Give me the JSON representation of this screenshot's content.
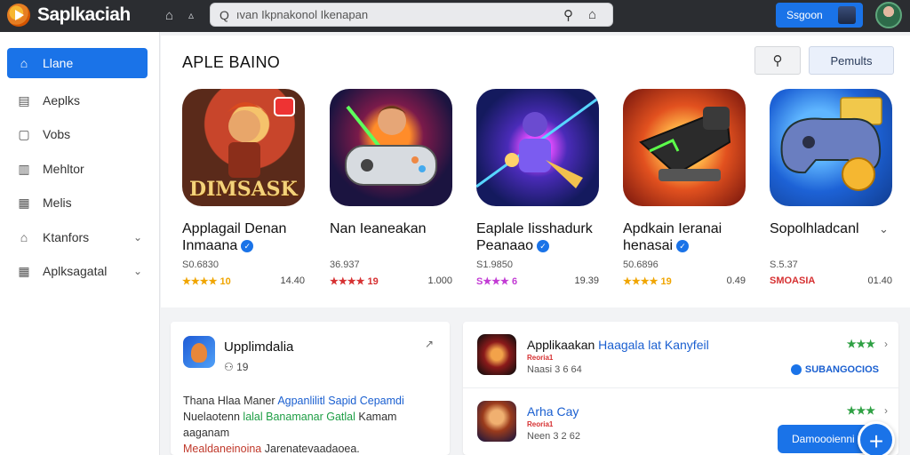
{
  "header": {
    "app_title": "Saplkaciah",
    "search_query_icon": "Q",
    "search_placeholder": "ıvan Ikpnakonol Ikenapan",
    "signin_label": "Ssgoon"
  },
  "sidebar": {
    "items": [
      {
        "label": "Llane",
        "icon": "home-icon"
      },
      {
        "label": "Aeplks",
        "icon": "apps-icon"
      },
      {
        "label": "Vobs",
        "icon": "docs-icon"
      },
      {
        "label": "Mehltor",
        "icon": "chart-icon"
      },
      {
        "label": "Melis",
        "icon": "calendar-icon"
      },
      {
        "label": "Ktanfors",
        "icon": "book-icon"
      },
      {
        "label": "Aplksagatal",
        "icon": "grid-icon"
      }
    ]
  },
  "main": {
    "section_title": "APLE BAINO",
    "permits_label": "Pemults",
    "apps": [
      {
        "name": "Applagail Denan Inmaana",
        "verified": true,
        "size": "S0.6830",
        "rating": "★★★★ 10",
        "price": "14.40",
        "icon_text": "DIMSASK"
      },
      {
        "name": "Nan Ieaneakan",
        "verified": false,
        "size": "36.937",
        "rating": "★★★★ 19",
        "price": "1.000"
      },
      {
        "name": "Eaplale Iisshadurk Peanaao",
        "verified": true,
        "size": "S1.9850",
        "rating": "S★★★ 6",
        "price": "19.39"
      },
      {
        "name": "Apdkain Ieranai henasai",
        "verified": true,
        "size": "50.6896",
        "rating": "★★★★ 19",
        "price": "0.49"
      },
      {
        "name": "Sopolhladcanl",
        "verified": false,
        "size": "S.5.37",
        "rating": "SMOASIA",
        "price": "01.40"
      }
    ]
  },
  "featured": {
    "title": "Upplimdalia",
    "sub": "19",
    "body_line1_a": "Thana Hlaa Maner ",
    "body_line1_b": "Agpanlilitl Sapid Cepamdi",
    "body_line2_a": "Nuelaotenn ",
    "body_line2_b": "lalal Banamanar Gatlal",
    "body_line2_c": " Kamam aaganam",
    "body_line3_a": "Mealdaneinoina",
    "body_line3_b": " Jarenatevaadaoea."
  },
  "list": {
    "rows": [
      {
        "title_a": "Applikaakan ",
        "title_b": "Haagala lat Kanyfeil",
        "tag": "Reoria1",
        "meta": "Naasi 3 6 64",
        "stars": "★★★",
        "status": "SUBANGOCIOS"
      },
      {
        "title_a": "",
        "title_b": "Arha Cay",
        "tag": "Reoria1",
        "meta": "Neen 3 2 62",
        "stars": "★★★"
      }
    ],
    "download_label": "Damoooienni"
  }
}
